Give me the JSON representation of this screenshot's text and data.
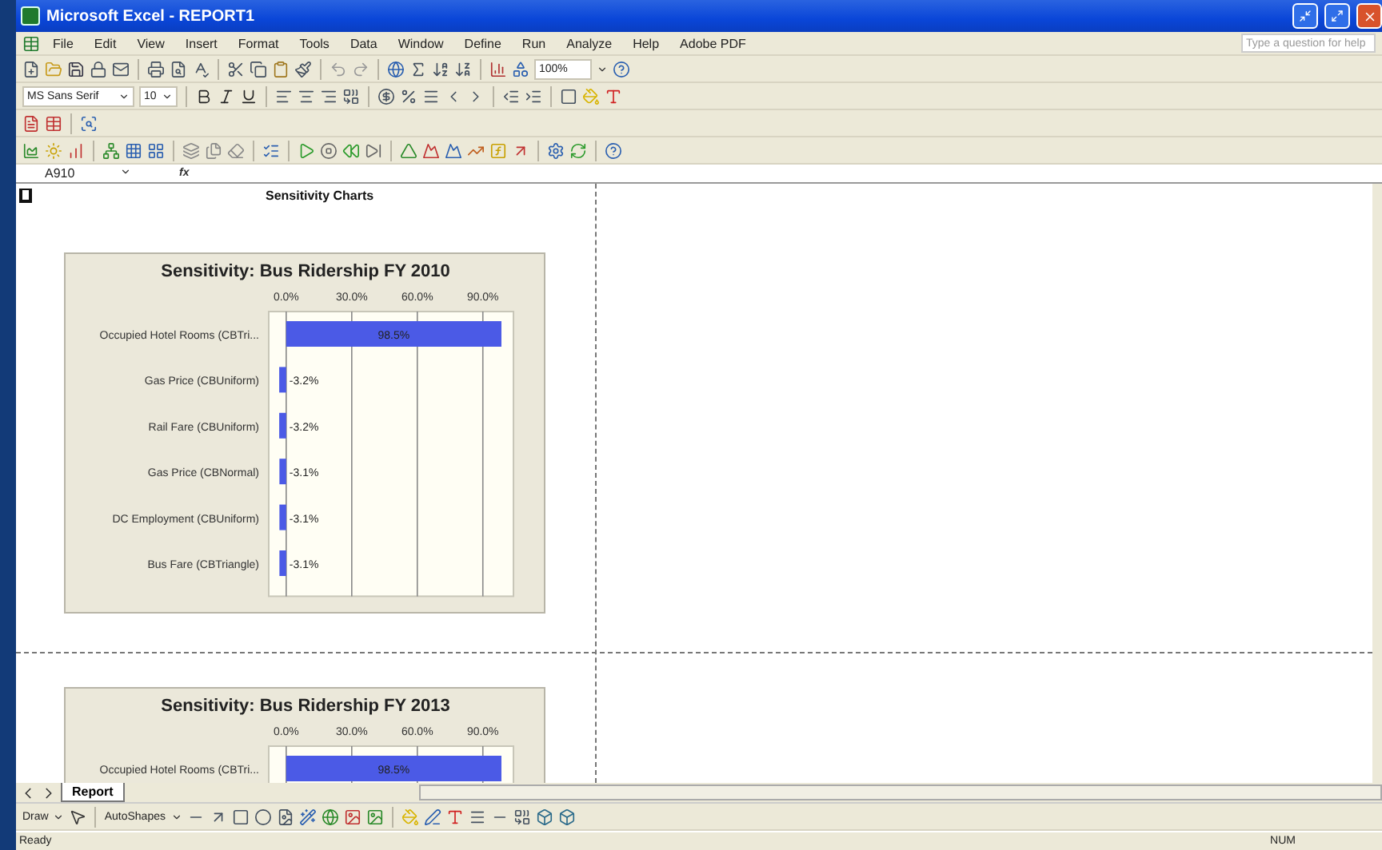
{
  "window": {
    "title": "Microsoft Excel - REPORT1"
  },
  "menu": [
    {
      "label": "File"
    },
    {
      "label": "Edit"
    },
    {
      "label": "View"
    },
    {
      "label": "Insert"
    },
    {
      "label": "Format"
    },
    {
      "label": "Tools"
    },
    {
      "label": "Data"
    },
    {
      "label": "Window"
    },
    {
      "label": "Define"
    },
    {
      "label": "Run"
    },
    {
      "label": "Analyze"
    },
    {
      "label": "Help"
    },
    {
      "label": "Adobe PDF"
    }
  ],
  "help_box": {
    "placeholder": "Type a question for help"
  },
  "toolbar": {
    "zoom": "100%",
    "font": "MS Sans Serif",
    "font_size": "10"
  },
  "formula_bar": {
    "name_box": "A910",
    "fx": "fx"
  },
  "sheet": {
    "heading": "Sensitivity Charts",
    "charts": [
      {
        "chart_data": {
          "type": "bar",
          "orientation": "horizontal",
          "title": "Sensitivity: Bus Ridership FY 2010",
          "categories": [
            "Occupied Hotel Rooms (CBTri...",
            "Gas Price (CBUniform)",
            "Rail Fare (CBUniform)",
            "Gas Price (CBNormal)",
            "DC Employment (CBUniform)",
            "Bus Fare (CBTriangle)"
          ],
          "series": [
            {
              "color": "#4b5ae6",
              "values": [
                98.5,
                -3.2,
                -3.2,
                -3.1,
                -3.1,
                -3.1
              ]
            }
          ],
          "value_labels": [
            "98.5%",
            "-3.2%",
            "-3.2%",
            "-3.1%",
            "-3.1%",
            "-3.1%"
          ],
          "grid": true,
          "xlim": [
            -8,
            104
          ],
          "xticks": [
            {
              "value": 0,
              "label": "0.0%"
            },
            {
              "value": 30,
              "label": "30.0%"
            },
            {
              "value": 60,
              "label": "60.0%"
            },
            {
              "value": 90,
              "label": "90.0%"
            }
          ]
        }
      },
      {
        "chart_data": {
          "type": "bar",
          "orientation": "horizontal",
          "title": "Sensitivity: Bus Ridership FY 2013",
          "categories": [
            "Occupied Hotel Rooms (CBTri..."
          ],
          "series": [
            {
              "color": "#4b5ae6",
              "values": [
                98.5
              ]
            }
          ],
          "value_labels": [
            "98.5%"
          ],
          "grid": true,
          "xlim": [
            -8,
            104
          ],
          "xticks": [
            {
              "value": 0,
              "label": "0.0%"
            },
            {
              "value": 30,
              "label": "30.0%"
            },
            {
              "value": 60,
              "label": "60.0%"
            },
            {
              "value": 90,
              "label": "90.0%"
            }
          ]
        }
      }
    ]
  },
  "sheet_tabs": [
    {
      "label": "Report",
      "selected": true
    }
  ],
  "drawing_toolbar": {
    "draw": "Draw",
    "autoshapes": "AutoShapes"
  },
  "status_bar": {
    "left": "Ready",
    "right": "NUM"
  }
}
